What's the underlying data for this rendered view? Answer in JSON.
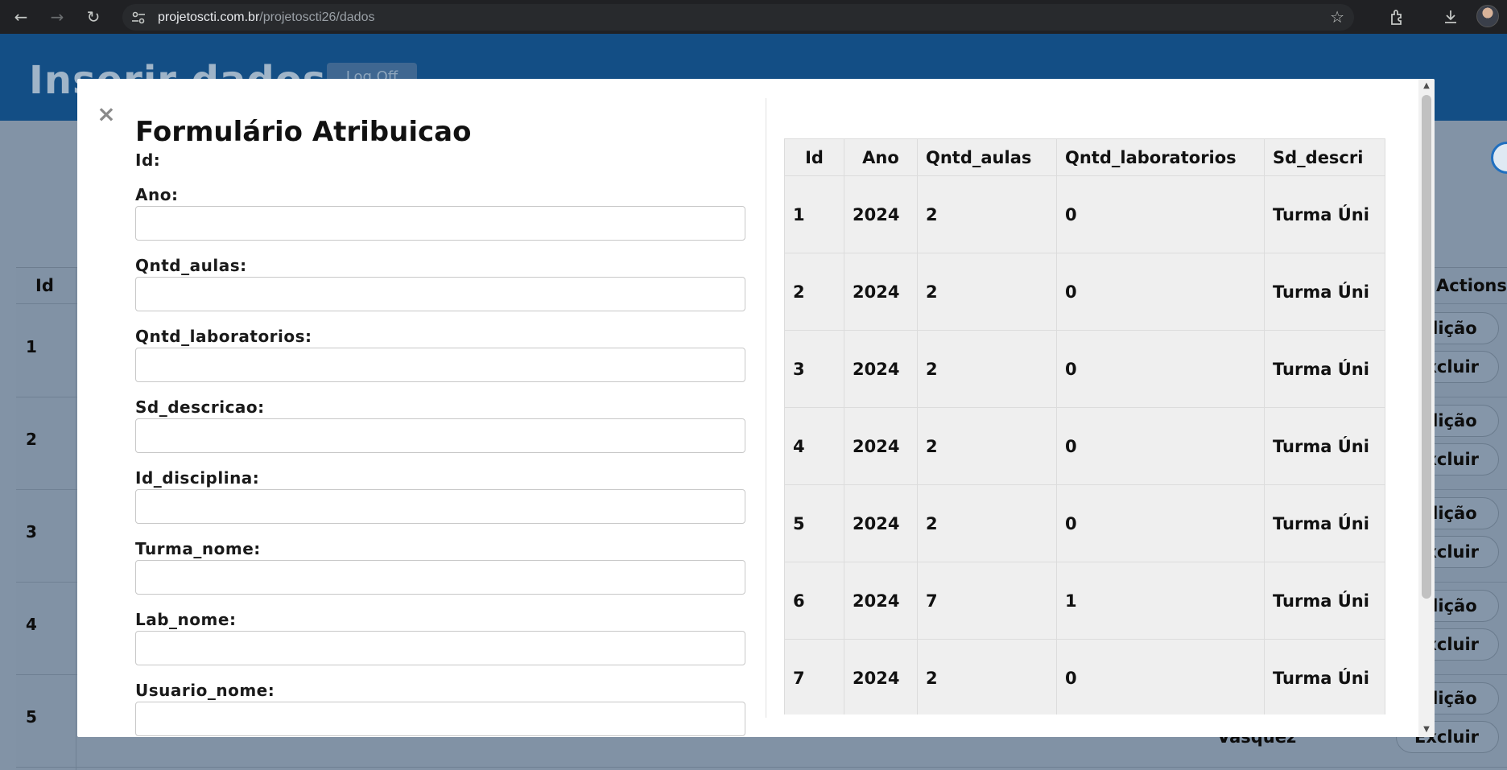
{
  "browser": {
    "url_host": "projetoscti.com.br",
    "url_path": "/projetoscti26/dados",
    "back_glyph": "←",
    "forward_glyph": "→",
    "reload_glyph": "↻",
    "star_glyph": "☆",
    "icons": [
      "back-icon",
      "forward-icon",
      "reload-icon",
      "site-settings-icon",
      "bookmark-star-icon",
      "extensions-icon",
      "download-icon",
      "profile-avatar"
    ]
  },
  "background_page": {
    "title": "Inserir dados",
    "logoff_label": "Log Off",
    "table_headers": {
      "id": "Id",
      "actions": "Actions"
    },
    "row_ids": [
      "1",
      "2",
      "3",
      "4",
      "5"
    ],
    "edit_label": "Edição",
    "delete_label": "Excluir",
    "partial_text": "Vasquez"
  },
  "modal": {
    "close_glyph": "×",
    "title": "Formulário Atribuicao",
    "fields": {
      "id": {
        "label": "Id:"
      },
      "ano": {
        "label": "Ano:",
        "value": ""
      },
      "qntd_aulas": {
        "label": "Qntd_aulas:",
        "value": ""
      },
      "qntd_laboratorios": {
        "label": "Qntd_laboratorios:",
        "value": ""
      },
      "sd_descricao": {
        "label": "Sd_descricao:",
        "value": ""
      },
      "id_disciplina": {
        "label": "Id_disciplina:",
        "value": ""
      },
      "turma_nome": {
        "label": "Turma_nome:",
        "value": ""
      },
      "lab_nome": {
        "label": "Lab_nome:",
        "value": ""
      },
      "usuario_nome": {
        "label": "Usuario_nome:",
        "value": ""
      }
    },
    "table": {
      "headers": [
        "Id",
        "Ano",
        "Qntd_aulas",
        "Qntd_laboratorios",
        "Sd_descri"
      ],
      "rows": [
        [
          "1",
          "2024",
          "2",
          "0",
          "Turma Úni"
        ],
        [
          "2",
          "2024",
          "2",
          "0",
          "Turma Úni"
        ],
        [
          "3",
          "2024",
          "2",
          "0",
          "Turma Úni"
        ],
        [
          "4",
          "2024",
          "2",
          "0",
          "Turma Úni"
        ],
        [
          "5",
          "2024",
          "2",
          "0",
          "Turma Úni"
        ],
        [
          "6",
          "2024",
          "7",
          "1",
          "Turma Úni"
        ],
        [
          "7",
          "2024",
          "2",
          "0",
          "Turma Úni"
        ]
      ]
    },
    "scroll_glyphs": {
      "up": "▲",
      "down": "▼",
      "left": "◀",
      "right": "▶"
    }
  },
  "colors": {
    "header_blue": "#134e85",
    "overlay": "#7d8ea1",
    "modal_bg": "#ffffff",
    "table_cell_bg": "#efefef"
  }
}
